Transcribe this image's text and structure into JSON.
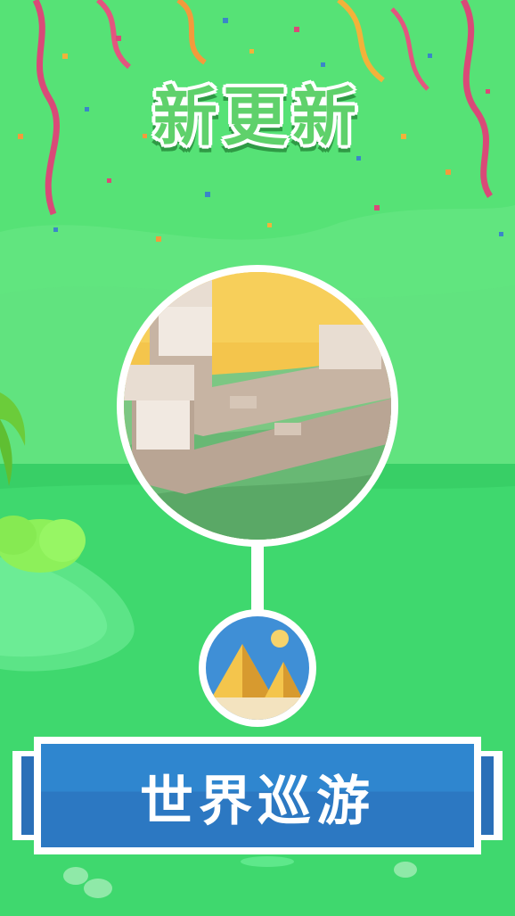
{
  "header": {
    "title": "新更新"
  },
  "feature": {
    "label": "世界巡游",
    "main_level": {
      "icon": "great-wall-icon"
    },
    "next_level": {
      "icon": "pyramids-icon"
    }
  },
  "colors": {
    "background": "#4fe070",
    "accent_green": "#5fd16b",
    "banner_blue": "#3a86c8",
    "banner_dark": "#1f5fa8",
    "ribbon": "#d94a78"
  }
}
